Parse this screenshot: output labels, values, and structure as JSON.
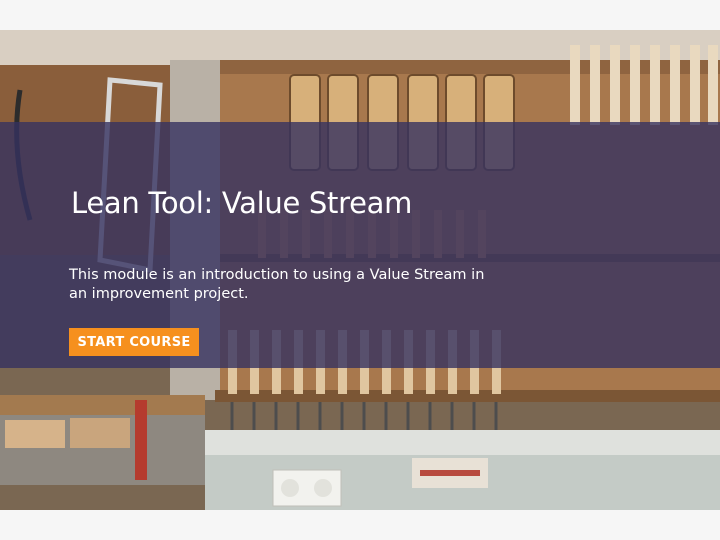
{
  "course": {
    "title": "Lean Tool: Value Stream",
    "description": "This module is an introduction to using a Value Stream in an improvement project.",
    "start_label": "START COURSE"
  },
  "colors": {
    "overlay": "#36326099",
    "accent": "#f6901e",
    "page_bg": "#f6f6f6"
  },
  "background_image": "workshop tool wall with chisels, saws and hand planes"
}
